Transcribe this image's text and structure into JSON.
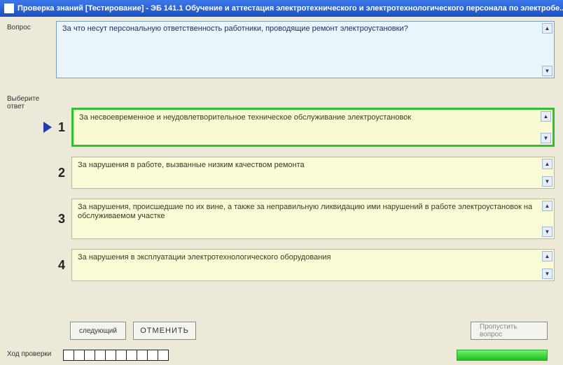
{
  "window": {
    "title": "Проверка знаний [Тестирование] - ЭБ 141.1 Обучение и аттестация электротехнического и электротехнологического персонала по электробе..."
  },
  "labels": {
    "question": "Вопрос",
    "answers_hint": "Выберите ответ",
    "progress": "Ход проверки"
  },
  "question": {
    "text": "За что несут персональную ответственность работники, проводящие ремонт электроустановки?"
  },
  "answers": [
    {
      "num": "1",
      "text": "За несвоевременное и неудовлетворительное техническое обслуживание электроустановок",
      "selected": true
    },
    {
      "num": "2",
      "text": "За нарушения в работе, вызванные низким качеством ремонта",
      "selected": false
    },
    {
      "num": "3",
      "text": "За нарушения, происшедшие по их вине, а также за неправильную ликвидацию ими нарушений в работе электроустановок на обслуживаемом участке",
      "selected": false
    },
    {
      "num": "4",
      "text": "За нарушения в эксплуатации электротехнологического оборудования",
      "selected": false
    }
  ],
  "buttons": {
    "prev": "следующий",
    "cancel": "ОТМЕНИТЬ",
    "next": "Пропустить вопрос"
  },
  "progress": {
    "total_cells": 10
  }
}
